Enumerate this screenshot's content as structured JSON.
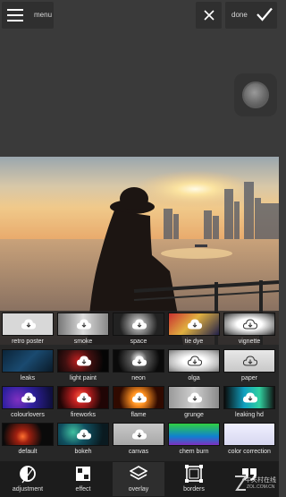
{
  "topbar": {
    "menu_label": "menu",
    "done_label": "done"
  },
  "tiles": [
    {
      "name": "retro poster",
      "cloud": true
    },
    {
      "name": "smoke",
      "cloud": true
    },
    {
      "name": "space",
      "cloud": true
    },
    {
      "name": "tie dye",
      "cloud": true
    },
    {
      "name": "vignette",
      "cloud": true
    },
    {
      "name": "leaks",
      "cloud": false
    },
    {
      "name": "light paint",
      "cloud": true
    },
    {
      "name": "neon",
      "cloud": true
    },
    {
      "name": "olga",
      "cloud": true
    },
    {
      "name": "paper",
      "cloud": true
    },
    {
      "name": "colourlovers",
      "cloud": true
    },
    {
      "name": "fireworks",
      "cloud": true
    },
    {
      "name": "flame",
      "cloud": true
    },
    {
      "name": "grunge",
      "cloud": true
    },
    {
      "name": "leaking hd",
      "cloud": true
    },
    {
      "name": "default",
      "cloud": false
    },
    {
      "name": "bokeh",
      "cloud": true
    },
    {
      "name": "canvas",
      "cloud": true
    },
    {
      "name": "chem burn",
      "cloud": false
    },
    {
      "name": "color correction",
      "cloud": false
    }
  ],
  "bottombar": [
    {
      "label": "adjustment",
      "icon": "adjustment-icon"
    },
    {
      "label": "effect",
      "icon": "effect-icon"
    },
    {
      "label": "overlay",
      "icon": "overlay-icon"
    },
    {
      "label": "borders",
      "icon": "borders-icon"
    },
    {
      "label": "stylize",
      "icon": "stylize-icon"
    }
  ],
  "watermark": {
    "line1": "中关村在线",
    "line2": "ZOL.COM.CN"
  },
  "colors": {
    "background": "#3a3a3a",
    "panel": "#222222",
    "accent": "#ffffff"
  }
}
